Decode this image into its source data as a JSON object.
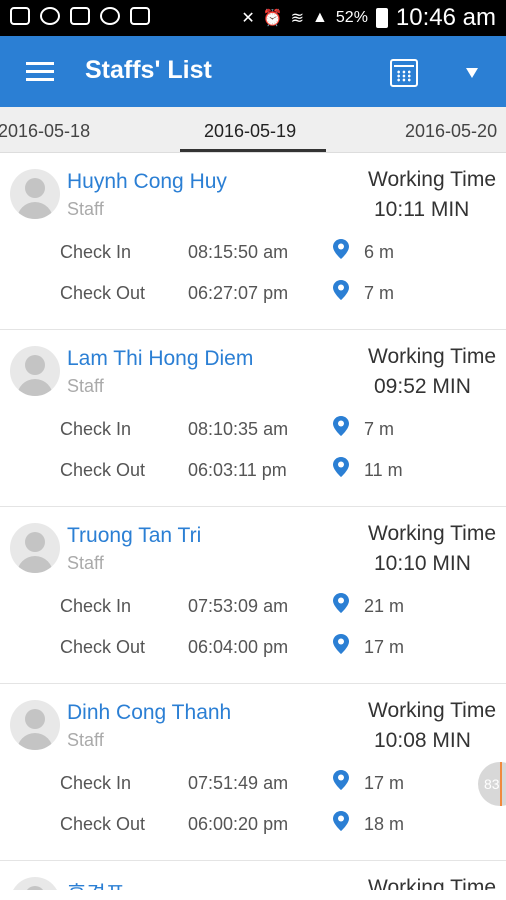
{
  "status_bar": {
    "battery": "52%",
    "time": "10:46 am"
  },
  "app_bar": {
    "title": "Staffs' List",
    "menu_icon": "hamburger-menu-icon",
    "calendar_icon": "calendar-icon",
    "dropdown_icon": "dropdown-arrow-icon",
    "color": "#2b7fd4"
  },
  "date_tabs": {
    "prev": "2016-05-18",
    "selected": "2016-05-19",
    "next": "2016-05-20"
  },
  "labels": {
    "working_time": "Working Time",
    "check_in": "Check In",
    "check_out": "Check Out"
  },
  "staff": [
    {
      "name": "Huynh Cong Huy",
      "role": "Staff",
      "working_time": "10:11 MIN",
      "check_in_time": "08:15:50 am",
      "check_in_distance": "6 m",
      "check_out_time": "06:27:07 pm",
      "check_out_distance": "7 m"
    },
    {
      "name": "Lam Thi Hong Diem",
      "role": "Staff",
      "working_time": "09:52 MIN",
      "check_in_time": "08:10:35 am",
      "check_in_distance": "7 m",
      "check_out_time": "06:03:11 pm",
      "check_out_distance": "11 m"
    },
    {
      "name": "Truong Tan Tri",
      "role": "Staff",
      "working_time": "10:10 MIN",
      "check_in_time": "07:53:09 am",
      "check_in_distance": "21 m",
      "check_out_time": "06:04:00 pm",
      "check_out_distance": "17 m"
    },
    {
      "name": "Dinh Cong Thanh",
      "role": "Staff",
      "working_time": "10:08 MIN",
      "check_in_time": "07:51:49 am",
      "check_in_distance": "17 m",
      "check_out_time": "06:00:20 pm",
      "check_out_distance": "18 m"
    },
    {
      "name": "홍경표",
      "working_time_label": "Working Time"
    }
  ],
  "floating_badge": "83"
}
